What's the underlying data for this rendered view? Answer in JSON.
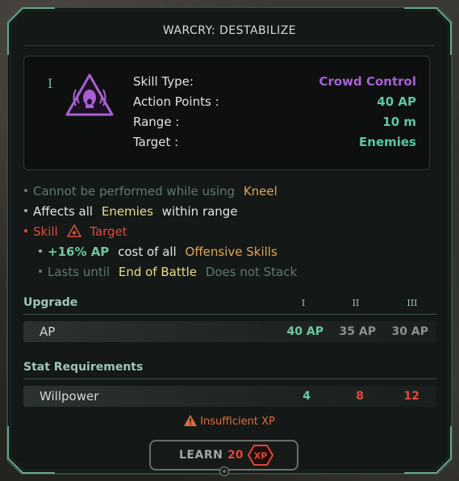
{
  "title": "WARCRY: DESTABILIZE",
  "tier": "I",
  "skill_icon": "shouting-head-warcry-icon",
  "stats": [
    {
      "label": "Skill Type:",
      "value": "Crowd Control",
      "color": "#a95fd4"
    },
    {
      "label": "Action Points :",
      "value": "40 AP",
      "color": "#5ec6a1"
    },
    {
      "label": "Range :",
      "value": "10 m",
      "color": "#5ec6a1"
    },
    {
      "label": "Target :",
      "value": "Enemies",
      "color": "#5ec6a1"
    }
  ],
  "effects": {
    "line1": {
      "pre": "Cannot be performed while using",
      "highlight": "Kneel"
    },
    "line2": {
      "pre": "Affects all",
      "highlight": "Enemies",
      "post": "within range"
    },
    "line3": {
      "pre": "Skill",
      "post": "Target"
    },
    "line4": {
      "value": "+16% AP",
      "mid": "cost of all",
      "highlight": "Offensive Skills"
    },
    "line5": {
      "pre": "Lasts until",
      "highlight": "End of Battle",
      "post": "Does not Stack"
    }
  },
  "upgrade": {
    "title": "Upgrade",
    "columns": [
      "I",
      "II",
      "III"
    ],
    "row_label": "AP",
    "values": [
      "40 AP",
      "35 AP",
      "30 AP"
    ]
  },
  "requirements": {
    "title": "Stat Requirements",
    "row_label": "Willpower",
    "values": [
      "4",
      "8",
      "12"
    ]
  },
  "warning": "Insufficient XP",
  "learn": {
    "label": "LEARN",
    "cost": "20",
    "currency": "XP"
  },
  "colors": {
    "accent_teal": "#5ec6a1",
    "skill_type_purple": "#a95fd4",
    "warning_red": "#e04a3e",
    "highlight_orange": "#e0a65a",
    "highlight_yellow": "#ecdc8c"
  }
}
